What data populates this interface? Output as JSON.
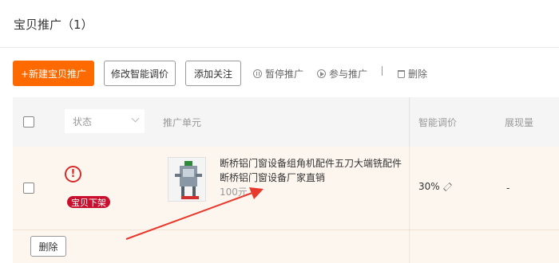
{
  "page": {
    "title": "宝贝推广（1）"
  },
  "toolbar": {
    "new_button": "+新建宝贝推广",
    "adjust_button": "修改智能调价",
    "follow_button": "添加关注",
    "pause_link": "暂停推广",
    "join_link": "参与推广",
    "delete_link": "删除"
  },
  "table": {
    "status_filter": "状态",
    "columns": [
      "推广单元",
      "智能调价",
      "展现量"
    ],
    "row": {
      "warning_symbol": "!",
      "status_badge": "宝贝下架",
      "product_title": "断桥铝门窗设备组角机配件五刀大端铣配件断桥铝门窗设备厂家直销",
      "product_price": "100元",
      "smart_price": "30%",
      "impressions": "-"
    },
    "bulk_delete": "删除"
  },
  "colors": {
    "primary": "#ff6a00",
    "danger": "#c8102e",
    "annotation_arrow": "#e8392d"
  },
  "icons": [
    "pause-circle-icon",
    "play-circle-icon",
    "trash-icon",
    "chevron-down-icon",
    "warning-icon",
    "pencil-icon"
  ]
}
